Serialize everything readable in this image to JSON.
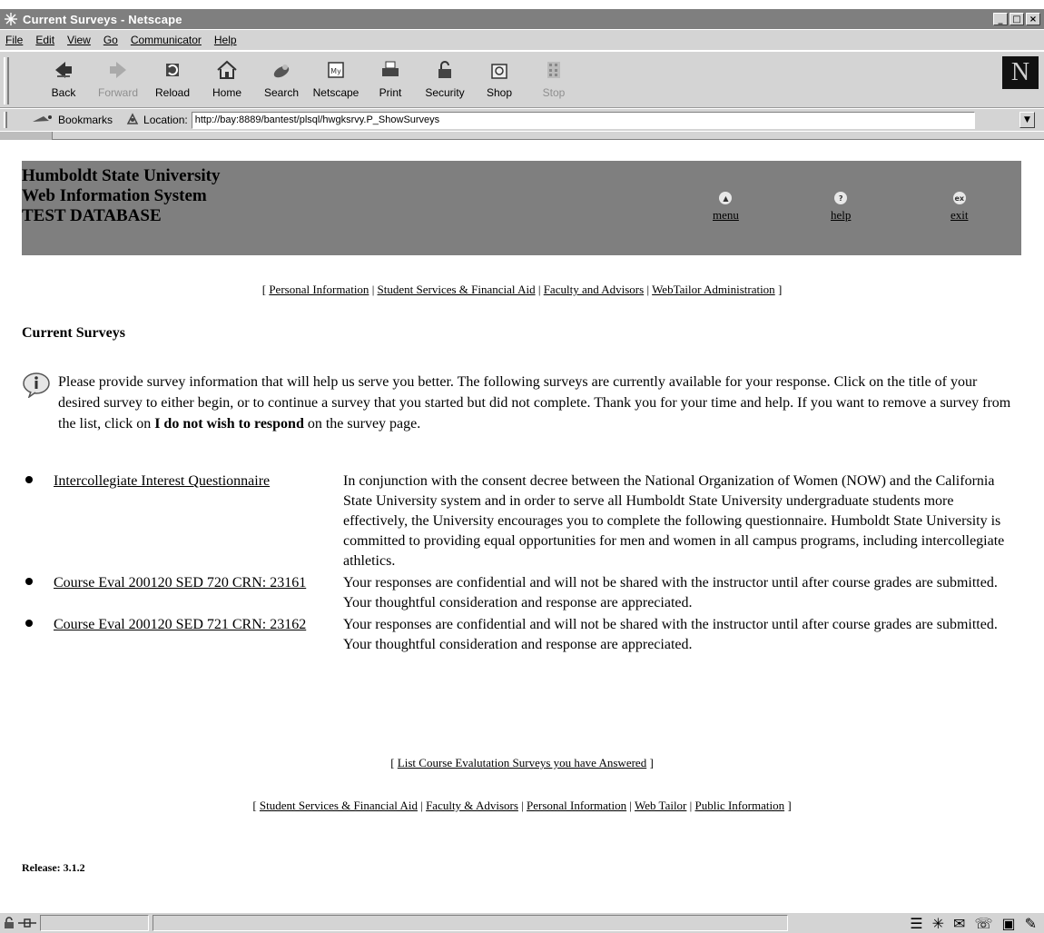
{
  "window": {
    "title": "Current Surveys - Netscape"
  },
  "menu": [
    "File",
    "Edit",
    "View",
    "Go",
    "Communicator",
    "Help"
  ],
  "toolbar": [
    {
      "label": "Back",
      "icon": "back-icon",
      "enabled": true
    },
    {
      "label": "Forward",
      "icon": "forward-icon",
      "enabled": false
    },
    {
      "label": "Reload",
      "icon": "reload-icon",
      "enabled": true
    },
    {
      "label": "Home",
      "icon": "home-icon",
      "enabled": true
    },
    {
      "label": "Search",
      "icon": "search-icon",
      "enabled": true
    },
    {
      "label": "Netscape",
      "icon": "netscape-icon",
      "enabled": true
    },
    {
      "label": "Print",
      "icon": "print-icon",
      "enabled": true
    },
    {
      "label": "Security",
      "icon": "security-icon",
      "enabled": true
    },
    {
      "label": "Shop",
      "icon": "shop-icon",
      "enabled": true
    },
    {
      "label": "Stop",
      "icon": "stop-icon",
      "enabled": false
    }
  ],
  "location": {
    "bookmarks_label": "Bookmarks",
    "location_label": "Location:",
    "url": "http://bay:8889/bantest/plsql/hwgksrvy.P_ShowSurveys"
  },
  "header": {
    "line1": "Humboldt State University",
    "line2": "Web Information System",
    "line3": "TEST DATABASE",
    "nav": [
      {
        "label": "menu",
        "icon": "menu-icon"
      },
      {
        "label": "help",
        "icon": "help-icon"
      },
      {
        "label": "exit",
        "icon": "exit-icon"
      }
    ]
  },
  "top_nav": [
    "Personal Information",
    "Student Services & Financial Aid",
    "Faculty and Advisors",
    "WebTailor Administration"
  ],
  "page_title": "Current Surveys",
  "info": {
    "text_before": "Please provide survey information that will help us serve you better. The following surveys are currently available for your response. Click on the title of your desired survey to either begin, or to continue a survey that you started but did not complete. Thank you for your time and help. If you want to remove a survey from the list, click on ",
    "bold": "I do not wish to respond",
    "text_after": " on the survey page."
  },
  "surveys": [
    {
      "title": "Intercollegiate Interest Questionnaire",
      "description": "In conjunction with the consent decree between the National Organization of Women (NOW) and the California State University system and in order to serve all Humboldt State University undergraduate students more effectively, the University encourages you to complete the following questionnaire. Humboldt State University is committed to providing equal opportunities for men and women in all campus programs, including intercollegiate athletics."
    },
    {
      "title": "Course Eval 200120 SED 720 CRN: 23161",
      "description": "Your responses are confidential and will not be shared with the instructor until after course grades are submitted. Your thoughtful consideration and response are appreciated."
    },
    {
      "title": "Course Eval 200120 SED 721 CRN: 23162",
      "description": "Your responses are confidential and will not be shared with the instructor until after course grades are submitted. Your thoughtful consideration and response are appreciated."
    }
  ],
  "mid_link": "List Course Evalutation Surveys you have Answered",
  "bottom_nav": [
    "Student Services & Financial Aid",
    "Faculty & Advisors",
    "Personal Information",
    "Web Tailor",
    "Public Information"
  ],
  "release": "Release: 3.1.2"
}
